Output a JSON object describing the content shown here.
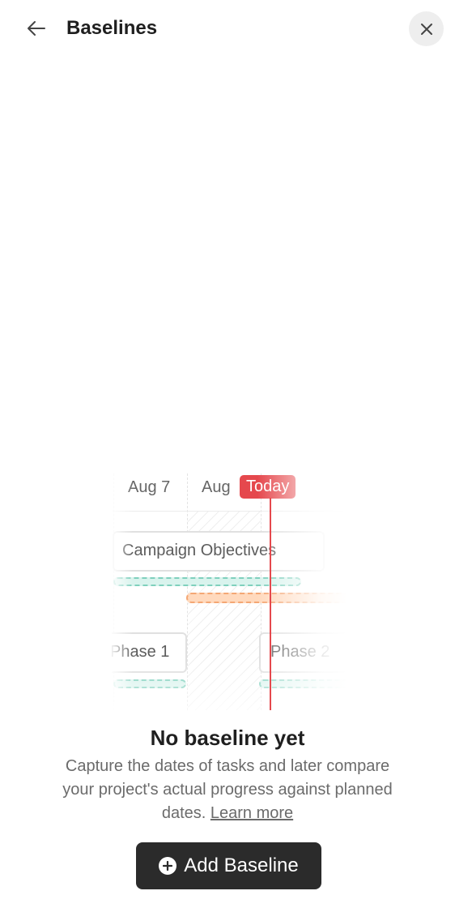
{
  "header": {
    "title": "Baselines",
    "back_icon": "arrow-left-icon",
    "close_icon": "close-icon"
  },
  "illustration": {
    "dates": [
      "Aug 7",
      "Aug"
    ],
    "today_label": "Today",
    "tasks": {
      "campaign": "Campaign Objectives",
      "phase1": "Phase 1",
      "phase2": "Phase 2"
    },
    "colors": {
      "today": "#e5484d",
      "baseline_bar": "#7fd0bd",
      "actual_bar": "#f4a774"
    }
  },
  "empty_state": {
    "title": "No baseline yet",
    "description": "Capture the dates of tasks and later compare your project's actual progress against planned dates.",
    "learn_more": "Learn more"
  },
  "actions": {
    "add_baseline_label": "Add Baseline",
    "add_icon": "plus-circle-icon"
  }
}
